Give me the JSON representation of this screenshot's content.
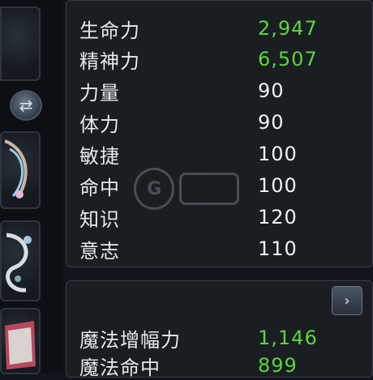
{
  "icons": {
    "swap": "swap-arrows-icon",
    "expand": "chevron-right-icon",
    "watermark": "g-logo-watermark"
  },
  "stats_main": [
    {
      "label": "生命力",
      "value": "2,947",
      "color": "#5ad63a"
    },
    {
      "label": "精神力",
      "value": "6,507",
      "color": "#5ad63a"
    },
    {
      "label": "力量",
      "value": "90",
      "color": "#f2f2f2"
    },
    {
      "label": "体力",
      "value": "90",
      "color": "#f2f2f2"
    },
    {
      "label": "敏捷",
      "value": "100",
      "color": "#f2f2f2"
    },
    {
      "label": "命中",
      "value": "100",
      "color": "#f2f2f2"
    },
    {
      "label": "知识",
      "value": "120",
      "color": "#f2f2f2"
    },
    {
      "label": "意志",
      "value": "110",
      "color": "#f2f2f2"
    }
  ],
  "stats_magic": [
    {
      "label": "魔法增幅力",
      "value": "1,146",
      "color": "#5ad63a"
    },
    {
      "label": "魔法命中",
      "value": "899",
      "color": "#5ad63a"
    }
  ]
}
